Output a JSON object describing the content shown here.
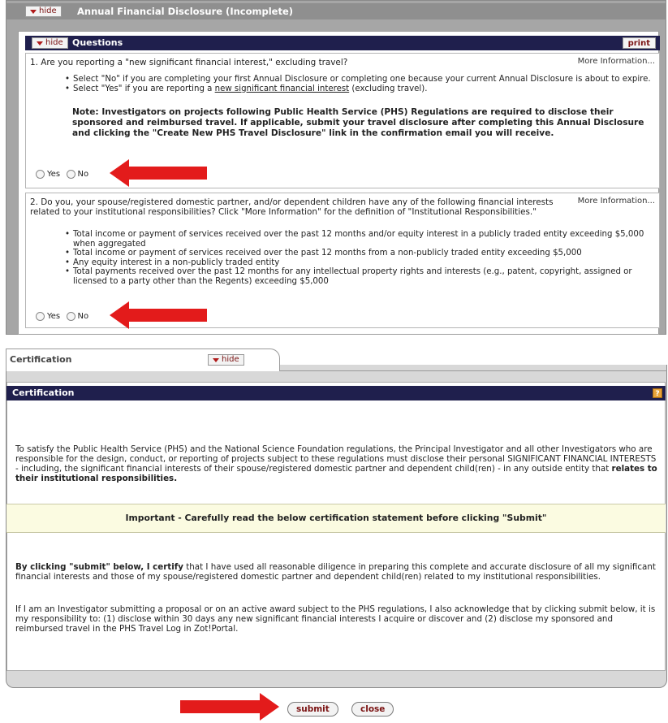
{
  "annual": {
    "hide_label": "hide",
    "title": "Annual Financial Disclosure (Incomplete)"
  },
  "questions": {
    "hide_label": "hide",
    "header": "Questions",
    "print_label": "print",
    "more_info": "More Information...",
    "q1": {
      "text": "1. Are you reporting a \"new significant financial interest,\" excluding travel?",
      "bullet1": "Select \"No\" if you are completing your first Annual Disclosure or completing one because your current Annual Disclosure is about to expire.",
      "bullet2_prefix": "Select \"Yes\" if you are reporting a ",
      "bullet2_link": "new significant financial interest",
      "bullet2_suffix": " (excluding travel).",
      "note": "Note: Investigators on projects following Public Health Service (PHS) Regulations are required to disclose their sponsored and reimbursed travel. If applicable, submit your travel disclosure after completing this Annual Disclosure and clicking the \"Create New PHS Travel Disclosure\" link in the confirmation email you will receive.",
      "yes": "Yes",
      "no": "No"
    },
    "q2": {
      "text": "2. Do you, your spouse/registered domestic partner, and/or dependent children have any of the following financial interests related to your institutional responsibilities? Click \"More Information\" for the definition of \"Institutional Responsibilities.\"",
      "bullets": [
        "Total income or payment of services received over the past 12 months and/or equity interest in a publicly traded entity exceeding $5,000 when aggregated",
        "Total income or payment of services received over the past 12 months from a non-publicly traded entity exceeding $5,000",
        "Any equity interest in a non-publicly traded entity",
        "Total payments received over the past 12 months for any intellectual property rights and interests (e.g., patent, copyright, assigned or licensed to a party other than the Regents) exceeding $5,000"
      ],
      "yes": "Yes",
      "no": "No"
    }
  },
  "certification": {
    "tab_title": "Certification",
    "hide_label": "hide",
    "header": "Certification",
    "help": "?",
    "para1_prefix": "To satisfy the Public Health Service (PHS) and the National Science Foundation regulations, the Principal Investigator and all other Investigators who are responsible for the design, conduct, or reporting of projects subject to these regulations must disclose their personal SIGNIFICANT FINANCIAL INTERESTS - including, the significant financial interests of their spouse/registered domestic partner and dependent child(ren) - in any outside entity that ",
    "para1_bold": "relates to their institutional responsibilities.",
    "important": "Important - Carefully read the below certification statement before clicking \"Submit\"",
    "para2_bold": "By clicking \"submit\" below, I certify",
    "para2_rest": " that I have used all reasonable diligence in preparing this complete and accurate disclosure of all my significant financial interests and those of my spouse/registered domestic partner and dependent child(ren) related to my institutional responsibilities.",
    "para3": "If I am an Investigator submitting a proposal or on an active award subject to the PHS regulations, I also acknowledge that by clicking submit below, it is my responsibility to: (1) disclose within 30 days any new significant financial interests I acquire or discover and (2) disclose my sponsored and reimbursed travel in the PHS Travel Log in Zot!Portal."
  },
  "actions": {
    "submit": "submit",
    "close": "close"
  },
  "colors": {
    "header_navy": "#1f1f4d",
    "arrow_red": "#e31b1b",
    "important_bg": "#fbfbe1"
  }
}
